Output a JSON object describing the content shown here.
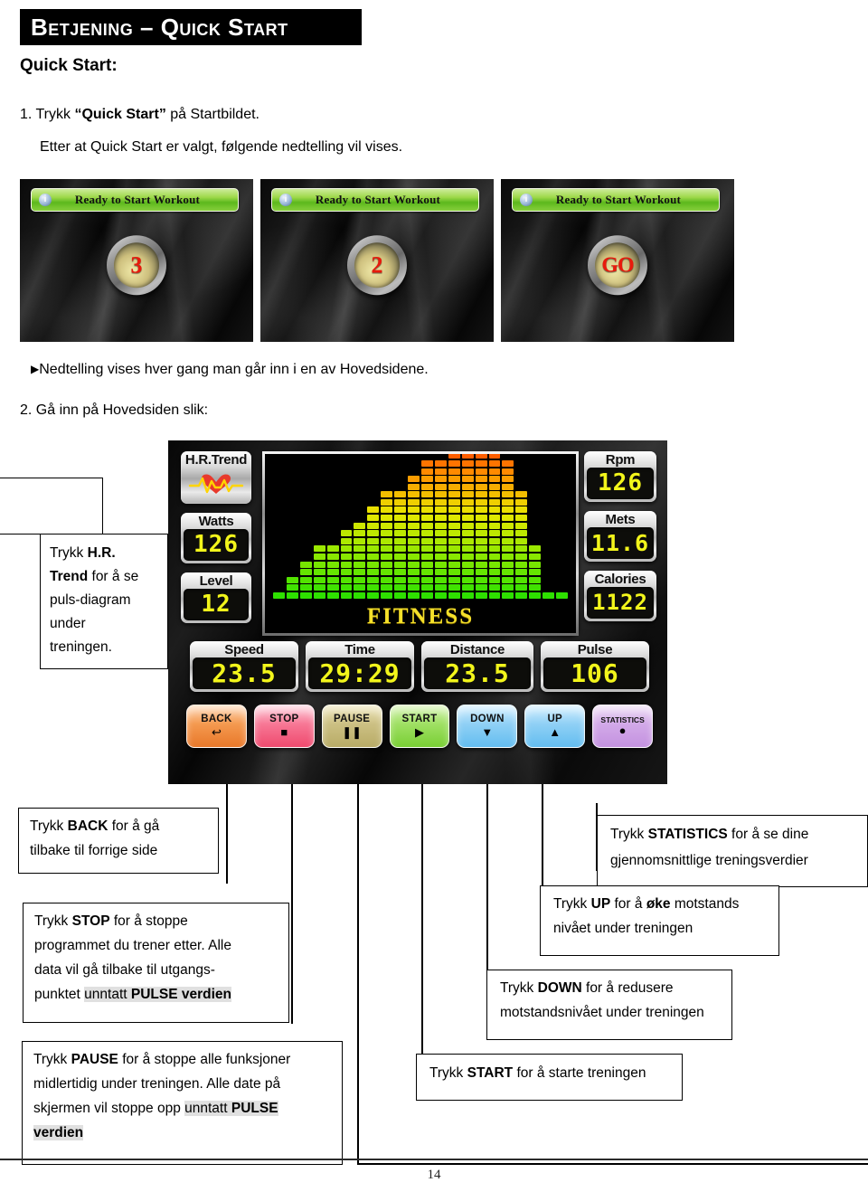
{
  "header": {
    "banner_title": "Betjening – Quick Start",
    "subtitle": "Quick Start:"
  },
  "steps": {
    "one_prefix": "1. Trykk ",
    "one_bold": "“Quick Start”",
    "one_suffix": " på Startbildet.",
    "one_sub": "Etter at Quick Start er valgt, følgende nedtelling vil vises.",
    "arrow_note": "Nedtelling vises hver gang man går inn i en av Hovedsidene.",
    "two": "2. Gå inn på Hovedsiden slik:"
  },
  "countdown": {
    "status_label": "Ready to Start Workout",
    "info_icon": "info-icon",
    "screens": [
      {
        "value": "3"
      },
      {
        "value": "2"
      },
      {
        "value": "GO"
      }
    ]
  },
  "hr_callout": {
    "l1a": "Trykk ",
    "l1b": "H.R.",
    "l2b": "Trend",
    "l2a": " for å se",
    "l3": "puls-diagram",
    "l4": "under",
    "l5": "treningen."
  },
  "console": {
    "hr_trend": {
      "caption": "H.R.Trend",
      "icon": "heartbeat-icon"
    },
    "watts": {
      "caption": "Watts",
      "value": "126"
    },
    "level": {
      "caption": "Level",
      "value": "12"
    },
    "rpm": {
      "caption": "Rpm",
      "value": "126"
    },
    "mets": {
      "caption": "Mets",
      "value": "11.6"
    },
    "calories": {
      "caption": "Calories",
      "value": "1122"
    },
    "speed": {
      "caption": "Speed",
      "value": "23.5"
    },
    "time": {
      "caption": "Time",
      "value": "29:29"
    },
    "distance": {
      "caption": "Distance",
      "value": "23.5"
    },
    "pulse": {
      "caption": "Pulse",
      "value": "106"
    },
    "chart_label": "FITNESS",
    "buttons": [
      {
        "label": "BACK",
        "glyph": "↩",
        "icon": "back-arrow-icon"
      },
      {
        "label": "STOP",
        "glyph": "■",
        "icon": "stop-square-icon"
      },
      {
        "label": "PAUSE",
        "glyph": "❚❚",
        "icon": "pause-bars-icon"
      },
      {
        "label": "START",
        "glyph": "▶",
        "icon": "play-triangle-icon"
      },
      {
        "label": "DOWN",
        "glyph": "▼",
        "icon": "down-triangle-icon"
      },
      {
        "label": "UP",
        "glyph": "▲",
        "icon": "up-triangle-icon"
      },
      {
        "label": "STATISTICS",
        "glyph": "●",
        "icon": "record-dot-icon"
      }
    ]
  },
  "chart_data": {
    "type": "bar",
    "title": "FITNESS",
    "xlabel": "",
    "ylabel": "",
    "grid": false,
    "legend": "none",
    "segment_count_max": 22,
    "categories": [
      "1",
      "2",
      "3",
      "4",
      "5",
      "6",
      "7",
      "8",
      "9",
      "10",
      "11",
      "12",
      "13",
      "14",
      "15",
      "16",
      "17",
      "18",
      "19",
      "20",
      "21",
      "22"
    ],
    "values": [
      1,
      3,
      5,
      7,
      7,
      9,
      10,
      12,
      14,
      14,
      16,
      18,
      18,
      20,
      22,
      22,
      22,
      18,
      14,
      7,
      1,
      1
    ],
    "colors_low_to_high": [
      "#2ee000",
      "#8ee800",
      "#e8e800",
      "#ff9000",
      "#ff1a00"
    ]
  },
  "callouts": {
    "back": {
      "l1a": "Trykk ",
      "l1b": "BACK",
      "l1c": " for å gå",
      "l2": "tilbake til forrige side"
    },
    "stop": {
      "l1a": "Trykk ",
      "l1b": "STOP",
      "l1c": " for å stoppe",
      "l2": "programmet du trener etter. Alle",
      "l3": "data vil gå tilbake til utgangs-",
      "l4a": "punktet ",
      "l4b": "unntatt ",
      "l4c": "PULSE verdien"
    },
    "pause": {
      "l1a": "Trykk ",
      "l1b": "PAUSE",
      "l1c": " for å stoppe alle funksjoner",
      "l2": "midlertidig under treningen. Alle date på",
      "l3a": "skjermen vil stoppe opp ",
      "l3b": "unntatt ",
      "l3c": "PULSE",
      "l4": "verdien"
    },
    "stats": {
      "l1a": "Trykk ",
      "l1b": "STATISTICS",
      "l1c": " for å se dine",
      "l2": "gjennomsnittlige treningsverdier"
    },
    "up": {
      "l1a": "Trykk ",
      "l1b": "UP",
      "l1c": " for å ",
      "l1d": "øke",
      "l1e": " motstands",
      "l2": "nivået under treningen"
    },
    "down": {
      "l1a": "Trykk ",
      "l1b": "DOWN",
      "l1c": " for å redusere",
      "l2": "motstandsnivået under treningen"
    },
    "start": {
      "l1a": "Trykk ",
      "l1b": "START",
      "l1c": " for å starte treningen"
    }
  },
  "footer": {
    "page_number": "14"
  }
}
